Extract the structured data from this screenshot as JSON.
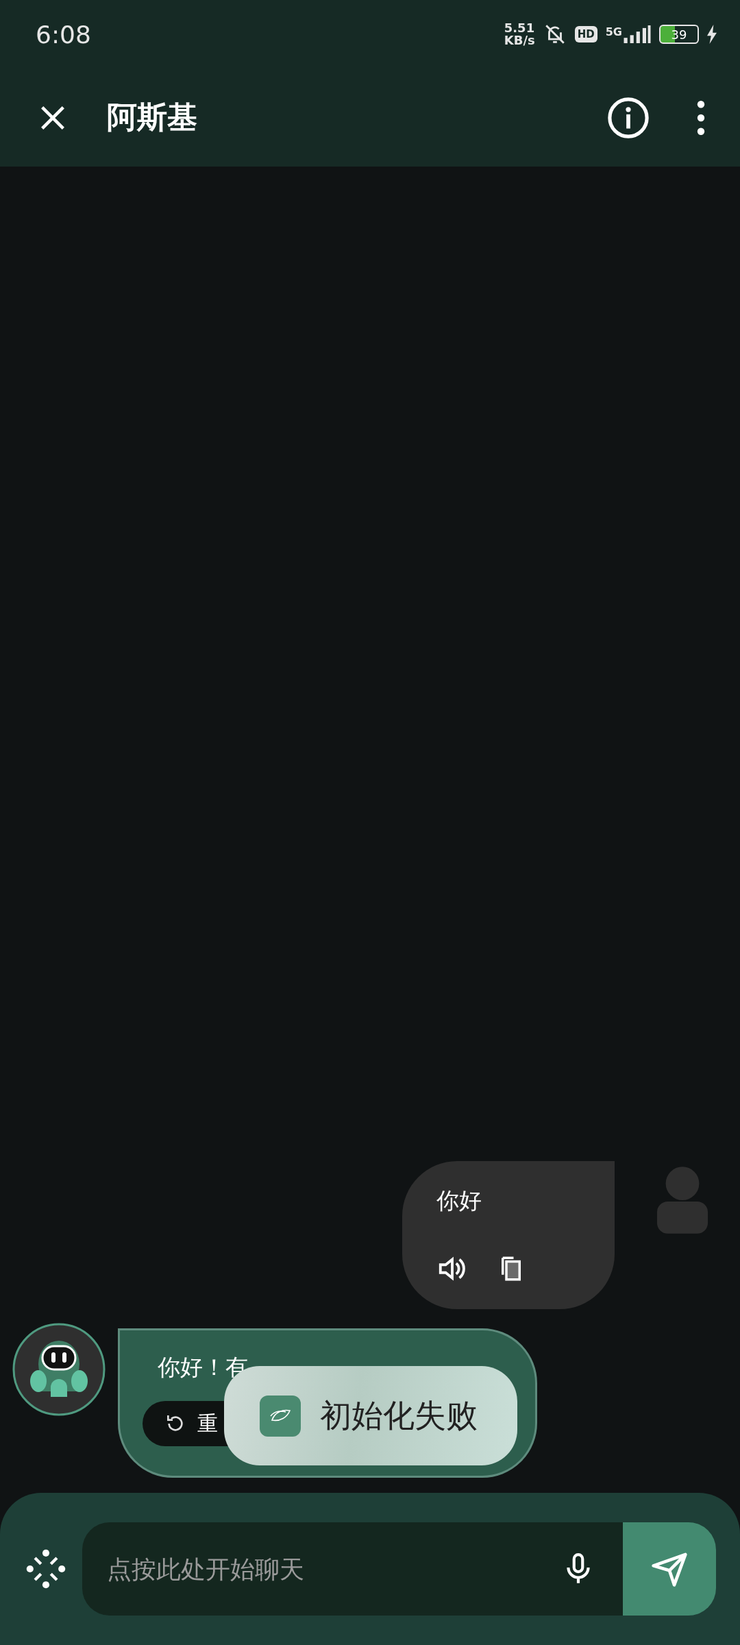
{
  "status_bar": {
    "time": "6:08",
    "speed_value": "5.51",
    "speed_unit": "KB/s",
    "hd": "HD",
    "network": "5G",
    "battery": "39"
  },
  "app_bar": {
    "title": "阿斯基"
  },
  "messages": [
    {
      "kind": "user",
      "text": "你好"
    },
    {
      "kind": "bot",
      "text": "你好！有",
      "action": "重"
    }
  ],
  "toast": {
    "text": "初始化失败"
  },
  "composer": {
    "placeholder": "点按此处开始聊天"
  }
}
